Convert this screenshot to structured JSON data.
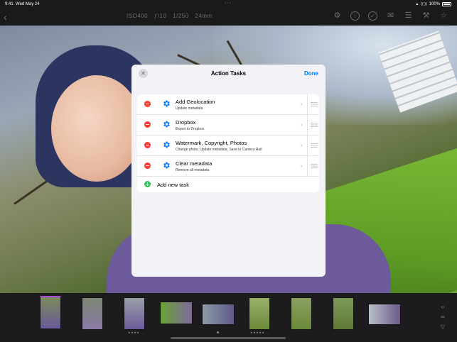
{
  "status_bar": {
    "time": "9:41",
    "date": "Wed May 24",
    "signal": "▲",
    "wifi": "((·))",
    "battery_text": "100%"
  },
  "toolbar": {
    "back_icon": "chevron-left-icon",
    "exif": "ISO400   ƒ/10   1/250   24mm",
    "icons": [
      "settings-icon",
      "info-icon",
      "check-icon",
      "mail-icon",
      "sliders-icon",
      "wrench-icon",
      "star-icon"
    ]
  },
  "modal": {
    "title": "Action Tasks",
    "close_label": "✕",
    "done_label": "Done",
    "tasks": [
      {
        "name": "Add Geolocation",
        "subtitle": "Update metadata"
      },
      {
        "name": "Dropbox",
        "subtitle": "Export to Dropbox"
      },
      {
        "name": "Watermark, Copyright, Photos",
        "subtitle": "Change photo, Update metadata, Save to Camera Roll"
      },
      {
        "name": "Clear metadata",
        "subtitle": "Remove all metadata"
      }
    ],
    "add_task_label": "Add new task"
  },
  "filmstrip": {
    "thumbs": [
      {
        "stars": ""
      },
      {
        "stars": ""
      },
      {
        "stars": "★★★★"
      },
      {
        "stars": ""
      },
      {
        "stars": ""
      },
      {
        "stars": "★★★★★"
      },
      {
        "stars": ""
      },
      {
        "stars": ""
      },
      {
        "stars": ""
      }
    ],
    "side_icons": [
      "code-icon",
      "compare-icon",
      "filter-icon"
    ]
  },
  "colors": {
    "accent": "#007aff",
    "delete": "#ff3b30",
    "add": "#34c759",
    "selected_thumb": "#b04ad8"
  }
}
